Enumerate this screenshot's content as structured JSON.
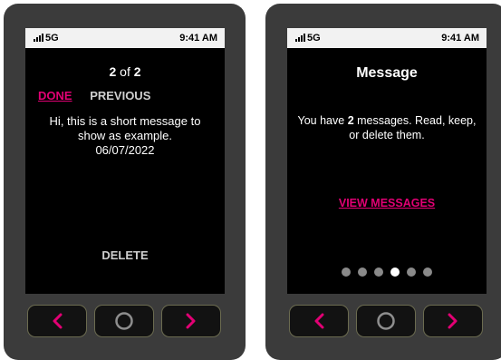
{
  "status_bar": {
    "network": "5G",
    "time": "9:41 AM"
  },
  "left_screen": {
    "counter_current": "2",
    "counter_of": "of",
    "counter_total": "2",
    "done_label": "DONE",
    "previous_label": "PREVIOUS",
    "message_text": "Hi, this is a short message to show as example.",
    "message_date": "06/07/2022",
    "delete_label": "DELETE"
  },
  "right_screen": {
    "title": "Message",
    "intro_prefix": "You have",
    "intro_count": "2",
    "intro_suffix": "messages. Read, keep, or delete them.",
    "view_messages_label": "VIEW MESSAGES",
    "page_dots_total": 6,
    "page_dots_active": 4
  },
  "hardware_buttons": {
    "left": "chevron-left-icon",
    "center": "circle-home-icon",
    "right": "chevron-right-icon"
  },
  "colors": {
    "accent": "#e20074",
    "device_body": "#3b3b3b",
    "screen": "#000000",
    "status_bar": "#f2f2f2"
  }
}
